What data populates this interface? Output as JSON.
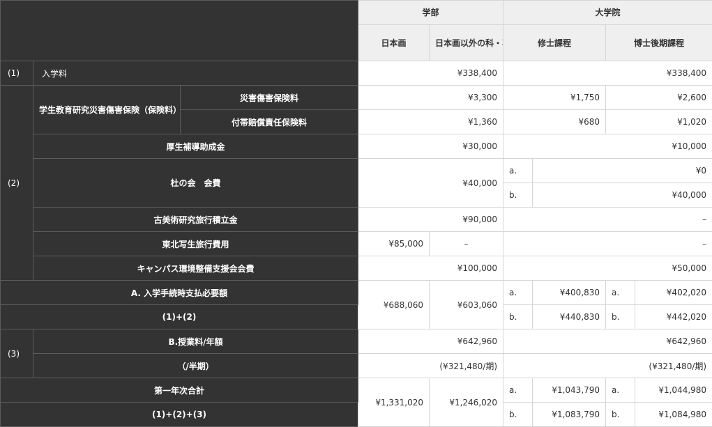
{
  "header": {
    "undergrad": "学部",
    "grad": "大学院",
    "nihonga": "日本画",
    "other_dept": "日本画以外の科・専攻",
    "masters": "修士課程",
    "doctoral": "博士後期課程"
  },
  "rows": {
    "admission": {
      "num": "(1)",
      "label": "入学料",
      "undergrad": "¥338,400",
      "grad": "¥338,400"
    },
    "group2_num": "(2)",
    "insurance": {
      "label": "学生教育研究災害傷害保険（保険料）",
      "disaster": {
        "label": "災害傷害保険料",
        "undergrad": "¥3,300",
        "masters": "¥1,750",
        "doctoral": "¥2,600"
      },
      "liability": {
        "label": "付帯賠償責任保険料",
        "undergrad": "¥1,360",
        "masters": "¥680",
        "doctoral": "¥1,020"
      }
    },
    "welfare": {
      "label": "厚生補導助成金",
      "undergrad": "¥30,000",
      "grad": "¥10,000"
    },
    "association": {
      "label": "杜の会　会費",
      "undergrad": "¥40,000",
      "a": "a.",
      "a_value": "¥0",
      "b": "b.",
      "b_value": "¥40,000"
    },
    "art_trip": {
      "label": "古美術研究旅行積立金",
      "undergrad": "¥90,000",
      "grad": "–"
    },
    "tohoku_trip": {
      "label": "東北写生旅行費用",
      "nihonga": "¥85,000",
      "other": "–",
      "grad": "–"
    },
    "campus": {
      "label": "キャンパス環境整備支援会会費",
      "undergrad": "¥100,000",
      "grad": "¥50,000"
    },
    "total_a": {
      "label": "A. 入学手続時支払必要額",
      "sublabel": "(1)+(2)",
      "nihonga": "¥688,060",
      "other": "¥603,060",
      "a": "a.",
      "b": "b.",
      "masters_a": "¥400,830",
      "masters_b": "¥440,830",
      "doctoral_a": "¥402,020",
      "doctoral_b": "¥442,020"
    },
    "group3_num": "(3)",
    "tuition": {
      "label": "B.授業料/年額",
      "undergrad": "¥642,960",
      "grad": "¥642,960"
    },
    "semester": {
      "label": "（/半期）",
      "undergrad": "(¥321,480/期)",
      "grad": "(¥321,480/期)"
    },
    "first_year": {
      "label": "第一年次合計",
      "sublabel": "(1)+(2)+(3)",
      "nihonga": "¥1,331,020",
      "other": "¥1,246,020",
      "a": "a.",
      "b": "b.",
      "masters_a": "¥1,043,790",
      "masters_b": "¥1,083,790",
      "doctoral_a": "¥1,044,980",
      "doctoral_b": "¥1,084,980"
    }
  }
}
